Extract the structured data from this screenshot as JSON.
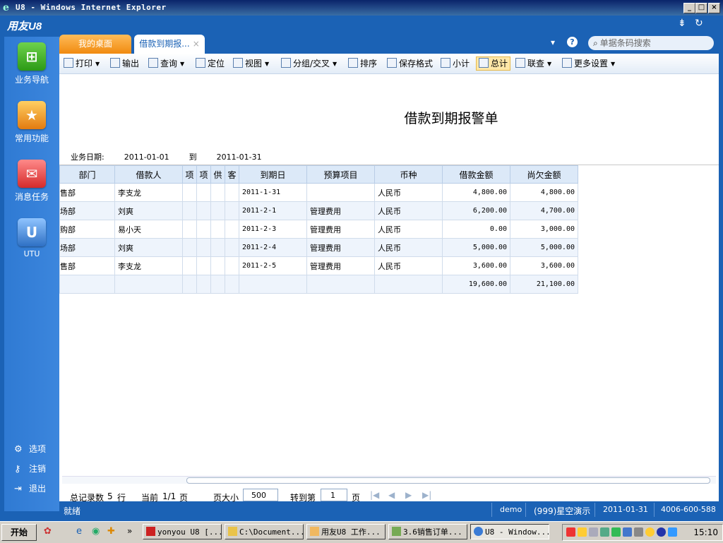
{
  "window": {
    "title": "U8 - Windows Internet Explorer",
    "minimize": "_",
    "maximize": "□",
    "close": "×"
  },
  "app": {
    "logo": "用友U8",
    "menu_icon": "⇟",
    "refresh_icon": "↻"
  },
  "sidebar": {
    "items": [
      {
        "label": "业务导航",
        "icon": "sitemap-icon",
        "glyph": "⊞"
      },
      {
        "label": "常用功能",
        "icon": "star-icon",
        "glyph": "★"
      },
      {
        "label": "消息任务",
        "icon": "mail-icon",
        "glyph": "✉"
      },
      {
        "label": "UTU",
        "icon": "utu-icon",
        "glyph": "U"
      }
    ],
    "options": [
      {
        "label": "选项",
        "icon": "gear-icon",
        "glyph": "⚙"
      },
      {
        "label": "注销",
        "icon": "key-icon",
        "glyph": "⚷"
      },
      {
        "label": "退出",
        "icon": "exit-icon",
        "glyph": "⇥"
      }
    ]
  },
  "tabs": [
    {
      "label": "我的桌面"
    },
    {
      "label": "借款到期报...",
      "close": "×"
    }
  ],
  "tab_tools": {
    "dropdown": "▾",
    "help": "?"
  },
  "search": {
    "icon": "search-icon",
    "glyph": "🔍",
    "placeholder": "单据条码搜索"
  },
  "toolbar": {
    "print": "打印",
    "export": "输出",
    "query": "查询",
    "locate": "定位",
    "view": "视图",
    "group": "分组/交叉",
    "sort": "排序",
    "save_format": "保存格式",
    "subtotal": "小计",
    "total": "总计",
    "link_query": "联查",
    "more": "更多设置"
  },
  "report": {
    "title": "借款到期报警单",
    "date_label": "业务日期:",
    "date_from": "2011-01-01",
    "date_to_label": "到",
    "date_to": "2011-01-31"
  },
  "table": {
    "headers": [
      "部门",
      "借款人",
      "项",
      "项",
      "供",
      "客",
      "到期日",
      "预算项目",
      "币种",
      "借款金额",
      "尚欠金额"
    ],
    "rows": [
      {
        "dept": "售部",
        "borrower": "李支龙",
        "due": "2011-1-31",
        "budget": "",
        "currency": "人民币",
        "loan": "4,800.00",
        "owed": "4,800.00"
      },
      {
        "dept": "场部",
        "borrower": "刘爽",
        "due": "2011-2-1",
        "budget": "管理费用",
        "currency": "人民币",
        "loan": "6,200.00",
        "owed": "4,700.00"
      },
      {
        "dept": "购部",
        "borrower": "易小天",
        "due": "2011-2-3",
        "budget": "管理费用",
        "currency": "人民币",
        "loan": "0.00",
        "owed": "3,000.00"
      },
      {
        "dept": "场部",
        "borrower": "刘爽",
        "due": "2011-2-4",
        "budget": "管理费用",
        "currency": "人民币",
        "loan": "5,000.00",
        "owed": "5,000.00"
      },
      {
        "dept": "售部",
        "borrower": "李支龙",
        "due": "2011-2-5",
        "budget": "管理费用",
        "currency": "人民币",
        "loan": "3,600.00",
        "owed": "3,600.00"
      }
    ],
    "total": {
      "loan": "19,600.00",
      "owed": "21,100.00"
    }
  },
  "pager": {
    "total_label": "总记录数",
    "total_count": "5",
    "total_unit": "行",
    "current_label": "当前",
    "current_value": "1/1",
    "current_unit": "页",
    "size_label": "页大小",
    "size_value": "500",
    "goto_label": "转到第",
    "goto_value": "1",
    "goto_unit": "页",
    "first": "|◀",
    "prev": "◀",
    "next": "▶",
    "last": "▶|"
  },
  "status": {
    "ready": "就绪",
    "user": "demo",
    "company": "(999)星空演示",
    "date": "2011-01-31",
    "phone": "4006-600-588"
  },
  "taskbar": {
    "start": "开始",
    "more": "»",
    "tasks": [
      {
        "label": "yonyou U8 [..."
      },
      {
        "label": "C:\\Document..."
      },
      {
        "label": "用友U8 工作..."
      },
      {
        "label": "3.6销售订单..."
      },
      {
        "label": "U8 - Window..."
      }
    ],
    "clock": "15:10"
  }
}
